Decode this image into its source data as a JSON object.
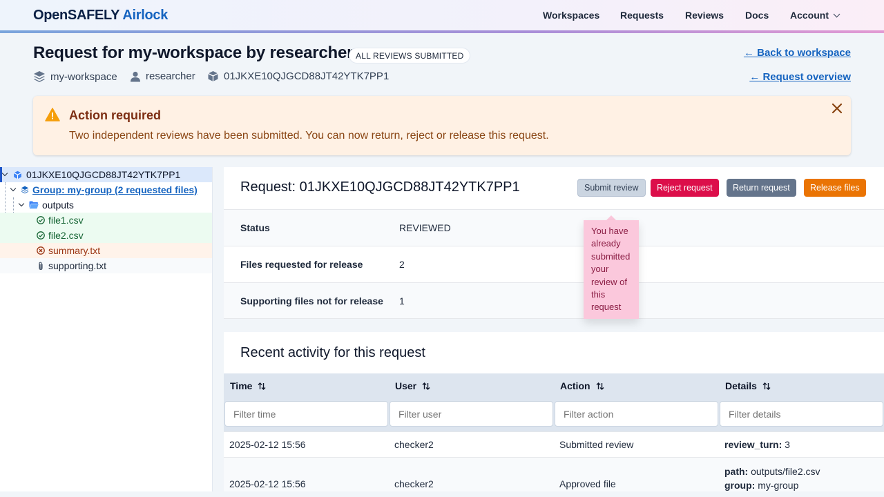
{
  "header": {
    "logo_part1": "OpenSAFELY",
    "logo_part2": "Airlock",
    "nav": [
      "Workspaces",
      "Requests",
      "Reviews",
      "Docs"
    ],
    "account_label": "Account"
  },
  "page": {
    "title": "Request for my-workspace by researcher",
    "status_badge": "ALL REVIEWS SUBMITTED",
    "workspace": "my-workspace",
    "user": "researcher",
    "request_id": "01JKXE10QJGCD88JT42YTK7PP1",
    "back_link": "← Back to workspace",
    "overview_link": "← Request overview"
  },
  "alert": {
    "title": "Action required",
    "text": "Two independent reviews have been submitted. You can now return, reject or release this request."
  },
  "tree": {
    "root": "01JKXE10QJGCD88JT42YTK7PP1",
    "group": "Group: my-group (2 requested files)",
    "folder": "outputs",
    "files": [
      {
        "name": "file1.csv",
        "status": "approved"
      },
      {
        "name": "file2.csv",
        "status": "approved"
      },
      {
        "name": "summary.txt",
        "status": "rejected"
      },
      {
        "name": "supporting.txt",
        "status": "supporting"
      }
    ]
  },
  "request": {
    "title": "Request: 01JKXE10QJGCD88JT42YTK7PP1",
    "buttons": {
      "submit": "Submit review",
      "reject": "Reject request",
      "return": "Return request",
      "release": "Release files"
    },
    "tooltip": "You have already submitted your review of this request",
    "rows": [
      {
        "label": "Status",
        "value": "REVIEWED"
      },
      {
        "label": "Files requested for release",
        "value": "2"
      },
      {
        "label": "Supporting files not for release",
        "value": "1"
      }
    ]
  },
  "activity": {
    "title": "Recent activity for this request",
    "columns": [
      "Time",
      "User",
      "Action",
      "Details"
    ],
    "filters": [
      "Filter time",
      "Filter user",
      "Filter action",
      "Filter details"
    ],
    "rows": [
      {
        "time": "2025-02-12 15:56",
        "user": "checker2",
        "action": "Submitted review",
        "details": [
          {
            "k": "review_turn:",
            "v": "3"
          }
        ]
      },
      {
        "time": "2025-02-12 15:56",
        "user": "checker2",
        "action": "Approved file",
        "details": [
          {
            "k": "path:",
            "v": "outputs/file2.csv"
          },
          {
            "k": "group:",
            "v": "my-group"
          }
        ]
      }
    ]
  },
  "colors": {
    "brand_dark": "#0b2146",
    "brand_blue": "#1664c0",
    "reject": "#dc0e4a",
    "return": "#64748b",
    "release": "#ea7404",
    "alert_bg": "#fff1e4"
  }
}
